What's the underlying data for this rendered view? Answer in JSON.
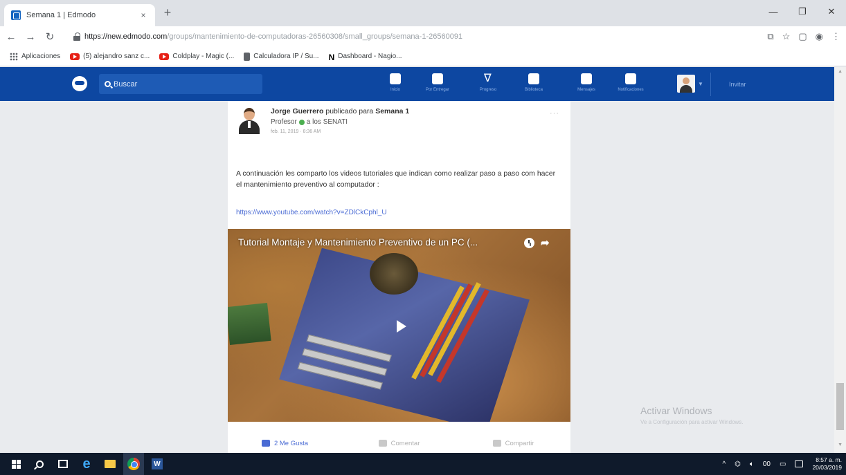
{
  "browser": {
    "tab_title": "Semana 1 | Edmodo",
    "url_domain": "https://new.edmodo.com",
    "url_path": "/groups/mantenimiento-de-computadoras-26560308/small_groups/semana-1-26560091",
    "bookmarks": [
      {
        "label": "Aplicaciones",
        "icon": "apps-icon"
      },
      {
        "label": "(5) alejandro sanz c...",
        "icon": "youtube-icon"
      },
      {
        "label": "Coldplay - Magic (...",
        "icon": "youtube-icon"
      },
      {
        "label": "Calculadora IP / Su...",
        "icon": "calculator-icon"
      },
      {
        "label": "Dashboard - Nagio...",
        "icon": "notion-icon"
      }
    ]
  },
  "edmodo": {
    "search_placeholder": "Buscar",
    "nav": [
      {
        "label": "Inicio",
        "icon": "home-icon"
      },
      {
        "label": "Por Entregar",
        "icon": "calendar-icon"
      },
      {
        "label": "Progreso",
        "icon": "pulse-icon"
      },
      {
        "label": "Biblioteca",
        "icon": "library-icon"
      },
      {
        "label": "Mensajes",
        "icon": "message-icon"
      },
      {
        "label": "Notificaciones",
        "icon": "bell-icon"
      }
    ],
    "invite_label": "Invitar"
  },
  "post": {
    "author": "Jorge Guerrero",
    "published_for": "publicado para",
    "group": "Semana 1",
    "role": "Profesor",
    "recipients": "a los SENATI",
    "date": "feb. 11, 2019 · 8:36 AM",
    "body": "A continuación les comparto los videos tutoriales que indican como realizar paso a paso com hacer el mantenimiento preventivo al computador :",
    "link": "https://www.youtube.com/watch?v=ZDlCkCphl_U",
    "video_title": "Tutorial Montaje y Mantenimiento Preventivo de un PC (...",
    "actions": {
      "like": "2 Me Gusta",
      "comment": "Comentar",
      "share": "Compartir"
    }
  },
  "watermark": {
    "line1": "Activar Windows",
    "line2": "Ve a Configuración para activar Windows."
  },
  "taskbar": {
    "time": "8:57 a. m.",
    "date": "20/03/2019"
  }
}
